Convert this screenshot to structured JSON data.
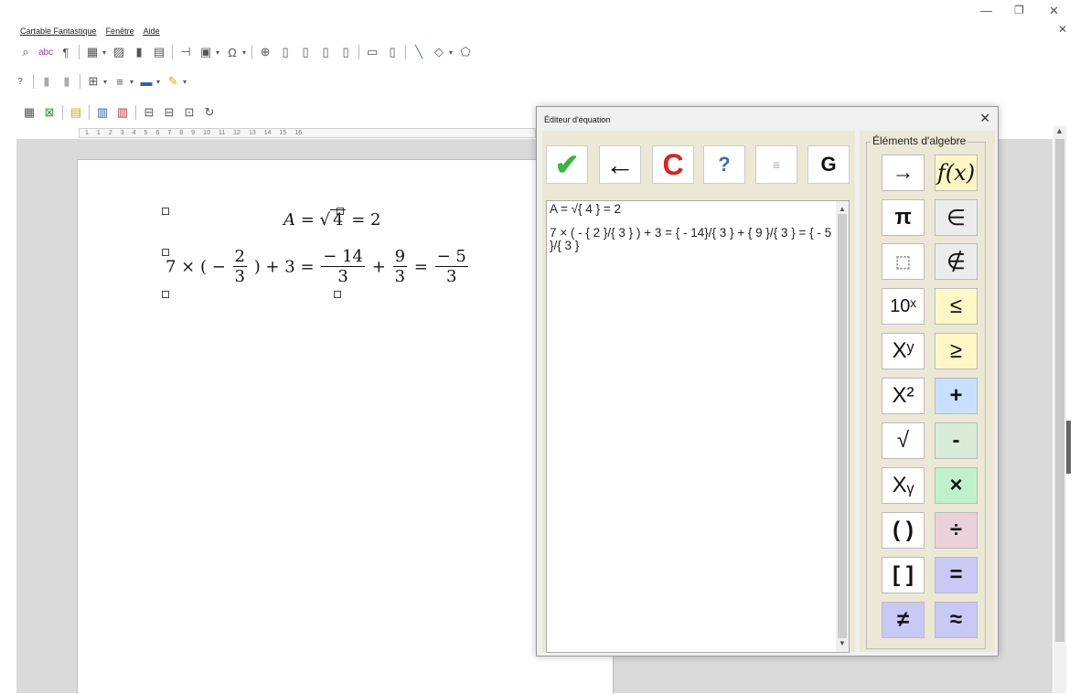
{
  "window": {
    "minimize": "—",
    "restore": "❐",
    "close": "✕",
    "doc_close": "✕"
  },
  "menu": [
    "Cartable Fantastique",
    "Fenêtre",
    "Aide"
  ],
  "ruler": [
    "1",
    "1",
    "2",
    "3",
    "4",
    "5",
    "6",
    "7",
    "8",
    "9",
    "10",
    "11",
    "12",
    "13",
    "14",
    "15",
    "16"
  ],
  "document": {
    "eq1": {
      "lhs": "A =",
      "radicand": "4",
      "rhs": "= 2"
    },
    "eq2": {
      "start": "7 × ( −",
      "f1": {
        "num": "2",
        "den": "3"
      },
      "mid": ") + 3 =",
      "f2": {
        "num": "− 14",
        "den": "3"
      },
      "plus": "+",
      "f3": {
        "num": "9",
        "den": "3"
      },
      "eq": "=",
      "f4": {
        "num": "− 5",
        "den": "3"
      }
    }
  },
  "dialog": {
    "title": "Éditeur d'équation",
    "close": "✕",
    "toolbar": {
      "validate": "✔",
      "back": "←",
      "clear": "C",
      "help": "?",
      "align": "≡",
      "bold": "G"
    },
    "text_lines": [
      "A = √{ 4 } = 2",
      "7 × ( - { 2 }/{ 3 } ) + 3 = { - 14}/{ 3 } + { 9 }/{ 3 } = { - 5 }/{ 3 }"
    ],
    "algebra": {
      "legend": "Éléments d'algebre",
      "buttons": [
        [
          "→",
          "f(x)"
        ],
        [
          "π",
          "∈"
        ],
        [
          "⬚",
          "∉"
        ],
        [
          "10ˣ",
          "≤"
        ],
        [
          "Xʸ",
          "≥"
        ],
        [
          "X²",
          "+"
        ],
        [
          "√",
          "-"
        ],
        [
          "Xᵧ",
          "×"
        ],
        [
          "( )",
          "÷"
        ],
        [
          "[ ]",
          "="
        ],
        [
          "≠",
          "≈"
        ]
      ]
    }
  },
  "icons": {
    "toolbar1": [
      "find-replace-icon",
      "spellcheck-icon",
      "formatting-marks-icon",
      "table-icon",
      "image-icon",
      "chart-icon",
      "textbox-icon",
      "page-break-icon",
      "field-icon",
      "special-char-icon",
      "hyperlink-icon",
      "footnote-icon",
      "endnote-icon",
      "bookmark-icon",
      "cross-ref-icon",
      "comment-icon",
      "track-changes-icon",
      "line-icon",
      "shape-icon",
      "draw-icon"
    ]
  }
}
